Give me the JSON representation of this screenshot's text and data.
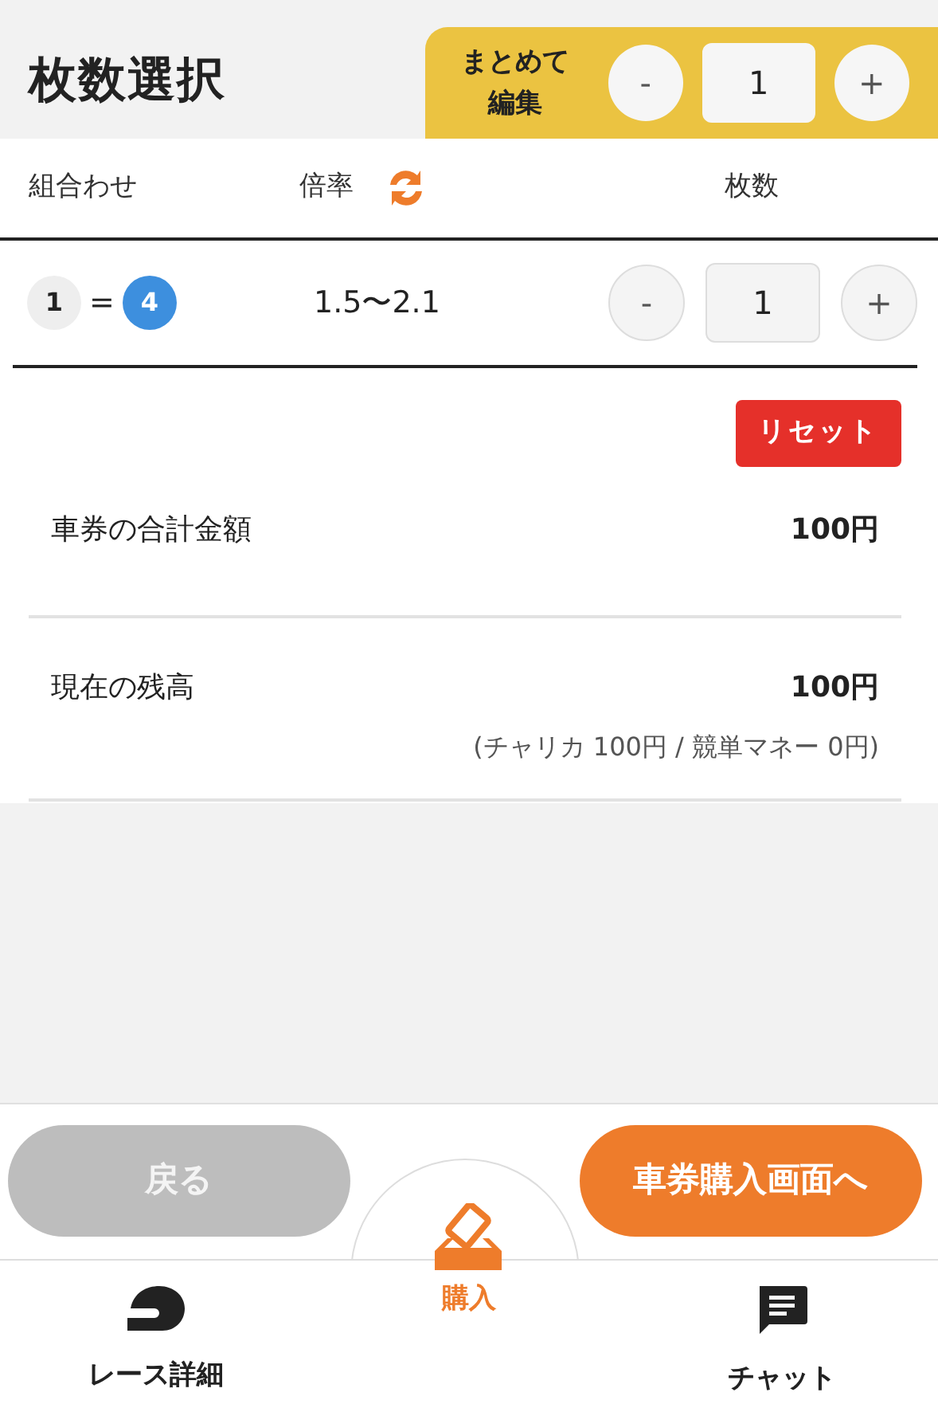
{
  "header": {
    "title": "枚数選択",
    "bulk_edit": {
      "label": "まとめて編集",
      "minus": "-",
      "value": "1",
      "plus": "+"
    }
  },
  "columns": {
    "combination": "組合わせ",
    "odds": "倍率",
    "count": "枚数"
  },
  "rows": [
    {
      "combination": [
        {
          "number": "1",
          "color": "#eeeeee"
        },
        {
          "number": "4",
          "color": "#3d8fde"
        }
      ],
      "separator": "=",
      "odds": "1.5〜2.1",
      "minus": "-",
      "value": "1",
      "plus": "+"
    }
  ],
  "reset_button": "リセット",
  "summary": [
    {
      "label": "車券の合計金額",
      "amount": "100円"
    },
    {
      "label": "現在の残高",
      "amount": "100円",
      "note": "(チャリカ 100円 / 競単マネー 0円)"
    }
  ],
  "actions": {
    "back": {
      "label": "戻る",
      "disabled": true
    },
    "next": {
      "label": "車券購入画面へ",
      "disabled": false
    }
  },
  "tabs": [
    {
      "label": "レース詳細",
      "kind": "helmet",
      "selected": false
    },
    {
      "label": "購入",
      "kind": "ticket",
      "selected": true
    },
    {
      "label": "チャット",
      "kind": "chat",
      "selected": false
    }
  ]
}
